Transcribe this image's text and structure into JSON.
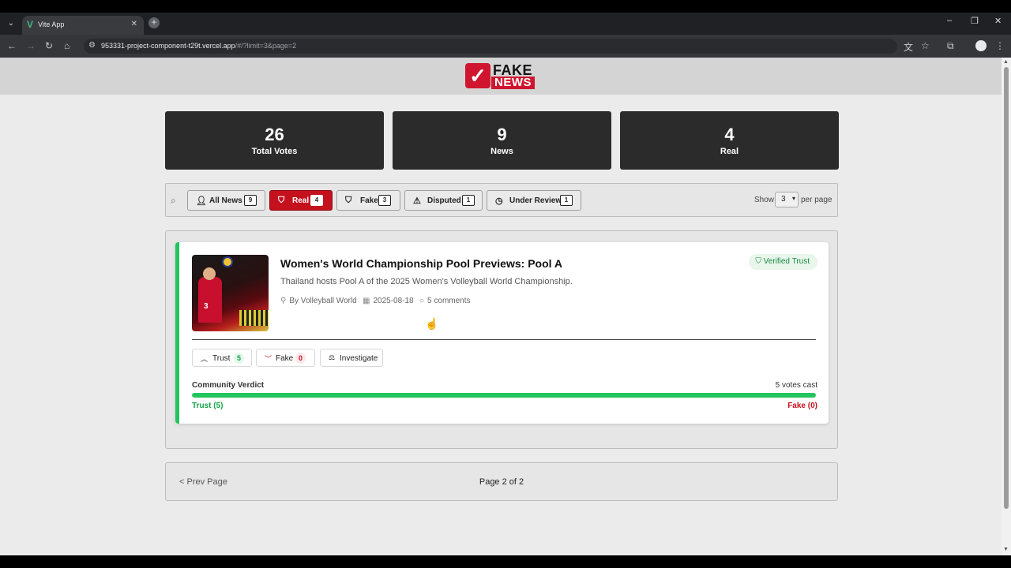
{
  "browser": {
    "tab_title": "Vite App",
    "url_host": "953331-project-component-t29t.vercel.app",
    "url_path": "/#/?limit=3&page=2"
  },
  "header": {
    "logo_fake": "FAKE",
    "logo_news": "NEWS"
  },
  "stats": [
    {
      "value": "26",
      "label": "Total Votes"
    },
    {
      "value": "9",
      "label": "News"
    },
    {
      "value": "4",
      "label": "Real"
    }
  ],
  "filters": [
    {
      "label": "All News",
      "count": "9",
      "icon": "user-icon"
    },
    {
      "label": "Real",
      "count": "4",
      "icon": "shield-check-icon",
      "active": true
    },
    {
      "label": "Fake",
      "count": "3",
      "icon": "shield-x-icon"
    },
    {
      "label": "Disputed",
      "count": "1",
      "icon": "warning-icon"
    },
    {
      "label": "Under Review",
      "count": "1",
      "icon": "clock-icon"
    }
  ],
  "per_page": {
    "show": "Show",
    "value": "3",
    "suffix": "per page"
  },
  "article": {
    "title": "Women's World Championship Pool Previews: Pool A",
    "description": "Thailand hosts Pool A of the 2025 Women's Volleyball World Championship.",
    "author": "By Volleyball World",
    "date": "2025-08-18",
    "comments": "5 comments",
    "badge": "Verified Trust",
    "trust_label": "Trust",
    "trust_count": "5",
    "fake_label": "Fake",
    "fake_count": "0",
    "investigate_label": "Investigate",
    "verdict_label": "Community Verdict",
    "votes_cast": "5 votes cast",
    "trust_summary": "Trust (5)",
    "fake_summary": "Fake (0)",
    "trust_fraction": 1.0,
    "accent_color": "#22c55e"
  },
  "pagination": {
    "prev": "< Prev Page",
    "info": "Page 2 of 2"
  }
}
